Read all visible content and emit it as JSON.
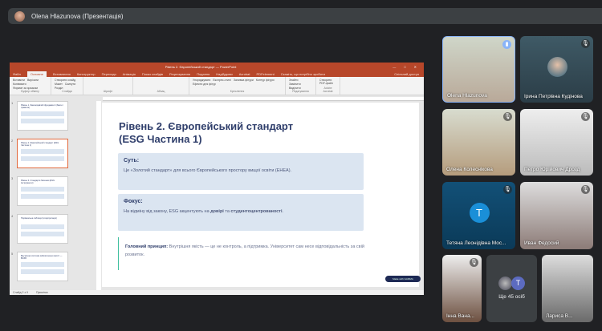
{
  "meeting": {
    "presenter_label": "Olena Hlazunova (Презентація)"
  },
  "powerpoint": {
    "title": "Рівень 2. Європейський стандарт — PowerPoint",
    "share": "Спільний доступ",
    "tell_me": "Скажіть, що потрібно зробити",
    "tabs": [
      "Файл",
      "Основне",
      "Вставлення",
      "Конструктор",
      "Переходи",
      "Анімація",
      "Показ слайдів",
      "Рецензування",
      "Подання",
      "Надбудови",
      "Acrobat",
      "PDFelement"
    ],
    "ribbon_groups": [
      "Буфер обміну",
      "Слайди",
      "Шрифт",
      "Абзац",
      "Креслення",
      "Редагування",
      "Adobe Acrobat"
    ],
    "ribbon_buttons": [
      "Вставити",
      "Вирізати",
      "Копіювати",
      "Формат за зразком",
      "Створити слайд",
      "Макет",
      "Скинути",
      "Розділ",
      "Упорядкувати",
      "Експрес-стилі",
      "Заливка фігури",
      "Контур фігури",
      "Ефекти для фігур",
      "Знайти",
      "Замінити",
      "Виділити",
      "Створити PDF-файл"
    ],
    "status": "Слайд 2 з 9",
    "notes": "Примітки"
  },
  "thumbnails": [
    {
      "num": "1",
      "title": "Рівень 1. Законодавчий фундамент (Закон і правила)"
    },
    {
      "num": "2",
      "title": "Рівень 2. Європейський стандарт (ESG Частина 1)",
      "selected": true
    },
    {
      "num": "3",
      "title": "Рівень 3. Стандарти бачення (ESG Інструменти)"
    },
    {
      "num": "4",
      "title": "Порівняльна таблиця (Інтерпретація)"
    },
    {
      "num": "5",
      "title": "Внутрішня система забезпечення якості — ВСЗЯ"
    }
  ],
  "slide": {
    "title_line1": "Рівень 2. Європейський стандарт",
    "title_line2": "(ESG Частина 1)",
    "box1_heading": "Суть:",
    "box1_text": "Це «Золотий стандарт» для всього Європейського простору вищої освіти (EHEA).",
    "box2_heading": "Фокус:",
    "box2_pre": "На відміну від закону, ESG акцентують на ",
    "box2_b1": "довірі",
    "box2_mid": " та ",
    "box2_b2": "студентоцентрованості",
    "box2_end": ".",
    "quote_label": "Головний принцип:",
    "quote_text": " Внутрішня якість — це не контроль, а підтримка. Університет сам несе відповідальність за свій розвиток.",
    "badge": "Made with GAMMA"
  },
  "participants": [
    {
      "name": "Olena Hlazunova",
      "speaking": true
    },
    {
      "name": "Ірина Петрівна Кудінова",
      "muted": true
    },
    {
      "name": "Олена Колеснікова",
      "muted": true
    },
    {
      "name": "Петро Юрійович Дрозд",
      "muted": true
    },
    {
      "name": "Тетяна Леонідівна Мос...",
      "muted": true,
      "initial": "T"
    },
    {
      "name": "Иван Федосий",
      "muted": true
    },
    {
      "name": "Інна Вана...",
      "muted": true
    },
    {
      "name": "Лариса В..."
    }
  ],
  "more": {
    "label": "Ще 45 осіб",
    "initial": "T"
  },
  "colors": {
    "ppt_red": "#b7472a",
    "slide_title": "#2f3e6b",
    "box_bg": "#dbe5f1",
    "accent_green": "#3fbf9f",
    "speaking": "#8ab4f8"
  }
}
